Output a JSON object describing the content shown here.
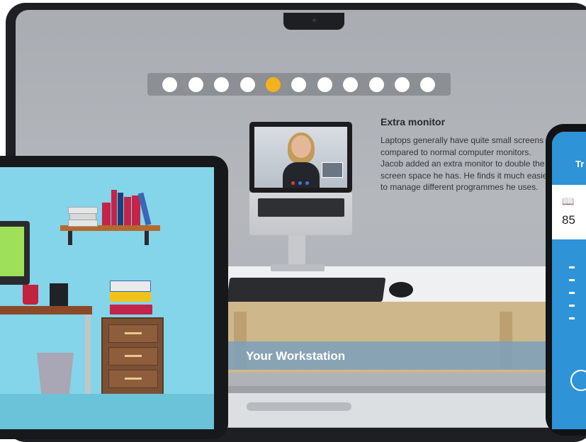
{
  "slideshow": {
    "dots_total": 11,
    "active_index": 4
  },
  "info": {
    "title": "Extra monitor",
    "text": "Laptops generally have quite small screens compared to normal computer monitors. Jacob added an extra monitor to double the screen space he has. He finds it much easier to manage different programmes he uses."
  },
  "banner": {
    "title": "Your Workstation"
  },
  "phone": {
    "header": "Tr",
    "value": "85",
    "icon": "book-icon"
  },
  "colors": {
    "active_dot": "#f3b21b",
    "dot": "#ffffff",
    "banner": "#7ba0bb",
    "tablet_bg": "#84d5e9",
    "phone_accent": "#2f93d8"
  }
}
